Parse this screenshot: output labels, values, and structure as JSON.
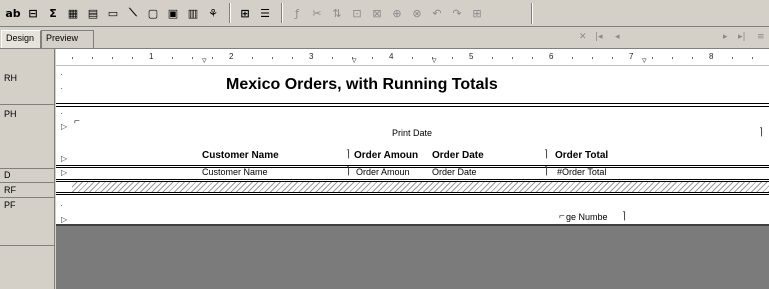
{
  "toolbar": {
    "buttons": [
      {
        "icon": "text-object-icon",
        "glyph": "ab"
      },
      {
        "icon": "field-icon",
        "glyph": "⊟"
      },
      {
        "icon": "sum-icon",
        "glyph": "Σ"
      },
      {
        "icon": "subreport-icon",
        "glyph": "▦"
      },
      {
        "icon": "crosstab-icon",
        "glyph": "▤"
      },
      {
        "icon": "ole-object-icon",
        "glyph": "▭"
      },
      {
        "icon": "line-icon",
        "glyph": "⟍"
      },
      {
        "icon": "box-icon",
        "glyph": "▢"
      },
      {
        "icon": "picture-icon",
        "glyph": "▣"
      },
      {
        "icon": "chart-icon",
        "glyph": "▥"
      },
      {
        "icon": "map-icon",
        "glyph": "⚘"
      },
      {
        "icon": "group-icon",
        "glyph": "⊞"
      },
      {
        "icon": "sort-icon",
        "glyph": "☰"
      },
      {
        "icon": "formula-icon",
        "glyph": "ƒ"
      },
      {
        "icon": "select-expert-icon",
        "glyph": "✂"
      },
      {
        "icon": "sort-expert-icon",
        "glyph": "⇅"
      },
      {
        "icon": "format-icon",
        "glyph": "⊡"
      },
      {
        "icon": "section-expert-icon",
        "glyph": "⊠"
      },
      {
        "icon": "highlight-icon",
        "glyph": "⊕"
      },
      {
        "icon": "link-icon",
        "glyph": "⊗"
      },
      {
        "icon": "undo-icon",
        "glyph": "↶"
      },
      {
        "icon": "redo-icon",
        "glyph": "↷"
      },
      {
        "icon": "zoom-icon",
        "glyph": "⊞"
      }
    ]
  },
  "tabs": {
    "design": "Design",
    "preview": "Preview"
  },
  "nav": {
    "close": "✕",
    "first": "|◂",
    "prev": "◂",
    "next": "▸",
    "last": "▸|",
    "menu": "≡"
  },
  "bands": {
    "rh": "RH",
    "ph": "PH",
    "d": "D",
    "rf": "RF",
    "pf": "PF"
  },
  "ruler": {
    "numbers": [
      "1",
      "2",
      "3",
      "4",
      "5",
      "6",
      "7",
      "8"
    ]
  },
  "report": {
    "title": "Mexico Orders, with Running Totals",
    "print_date": "Print Date",
    "headers": {
      "customer_name": "Customer Name",
      "order_amount": "Order Amoun",
      "order_date": "Order Date",
      "order_total": "Order Total"
    },
    "details": {
      "customer_name": "Customer Name",
      "order_amount": "Order Amoun",
      "order_date": "Order Date",
      "order_total": "#Order Total"
    },
    "page_number": "ge Numbe"
  }
}
